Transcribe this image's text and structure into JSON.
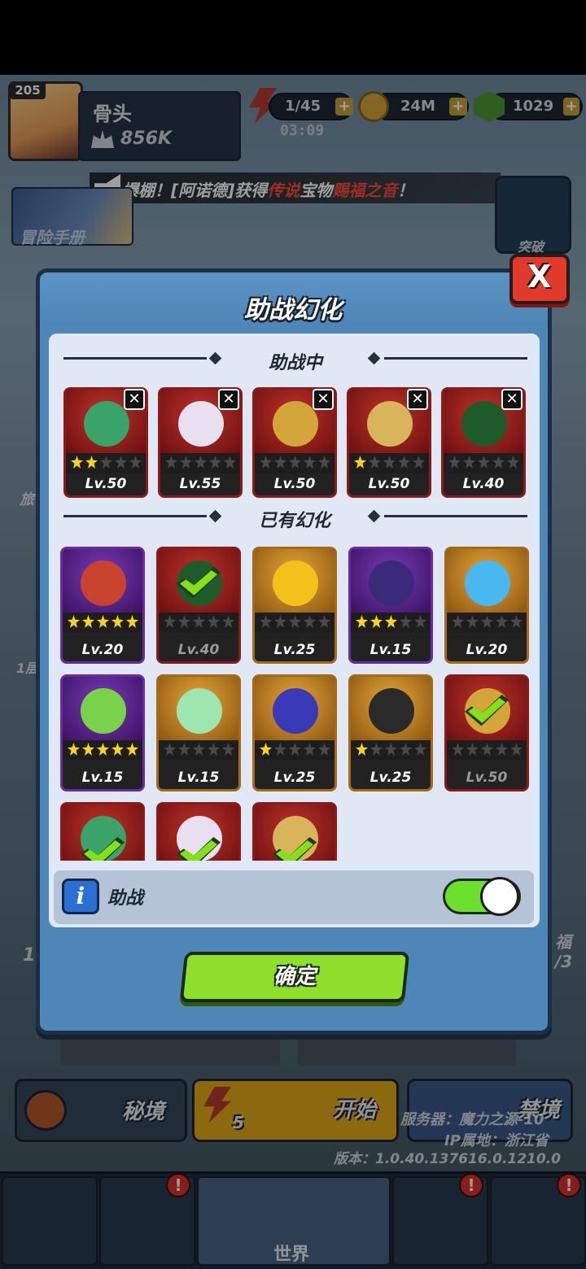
{
  "hud": {
    "player_level": "205",
    "player_name": "骨头",
    "power": "856K",
    "energy": "1/45",
    "energy_timer": "03:09",
    "coins": "24M",
    "gems": "1029",
    "plus_label": "+"
  },
  "ticker": {
    "prefix": "爆棚！[阿诺德]获得",
    "rarity": "传说",
    "middle": "宝物",
    "item": "赐福之音",
    "suffix": "！"
  },
  "side": {
    "handbook_label": "冒险手册"
  },
  "modal": {
    "title": "助战幻化",
    "close_label": "X",
    "active_section_title": "助战中",
    "owned_section_title": "已有幻化",
    "remove_label": "✕",
    "active": [
      {
        "level": "Lv.50",
        "stars": 2,
        "frame": "red",
        "color": "#3aa36a"
      },
      {
        "level": "Lv.55",
        "stars": 0,
        "frame": "red",
        "color": "#e8dff0"
      },
      {
        "level": "Lv.50",
        "stars": 0,
        "frame": "red",
        "color": "#d4a63a"
      },
      {
        "level": "Lv.50",
        "stars": 1,
        "frame": "red",
        "color": "#d8b45a"
      },
      {
        "level": "Lv.40",
        "stars": 0,
        "frame": "red",
        "color": "#1e5a2a"
      }
    ],
    "owned": [
      {
        "level": "Lv.20",
        "stars": 5,
        "frame": "purple",
        "color": "#c8432e",
        "checked": false
      },
      {
        "level": "Lv.40",
        "stars": 0,
        "frame": "red",
        "color": "#1e5a2a",
        "checked": true
      },
      {
        "level": "Lv.25",
        "stars": 0,
        "frame": "gold",
        "color": "#f2c21a",
        "checked": false
      },
      {
        "level": "Lv.15",
        "stars": 3,
        "frame": "purple",
        "color": "#3a2a7a",
        "checked": false
      },
      {
        "level": "Lv.20",
        "stars": 0,
        "frame": "gold",
        "color": "#4ab8f0",
        "checked": false
      },
      {
        "level": "Lv.15",
        "stars": 5,
        "frame": "purple",
        "color": "#7ad24a",
        "checked": false
      },
      {
        "level": "Lv.15",
        "stars": 0,
        "frame": "gold",
        "color": "#9ee6b0",
        "checked": false
      },
      {
        "level": "Lv.25",
        "stars": 1,
        "frame": "gold",
        "color": "#3a3ab8",
        "checked": false
      },
      {
        "level": "Lv.25",
        "stars": 1,
        "frame": "gold",
        "color": "#2a2a2a",
        "checked": false
      },
      {
        "level": "Lv.50",
        "stars": 0,
        "frame": "red",
        "color": "#d4a63a",
        "checked": true
      },
      {
        "level": "",
        "stars": 0,
        "frame": "red",
        "color": "#3aa36a",
        "checked": true
      },
      {
        "level": "",
        "stars": 0,
        "frame": "red",
        "color": "#e8dff0",
        "checked": true
      },
      {
        "level": "",
        "stars": 0,
        "frame": "red",
        "color": "#d8b45a",
        "checked": true
      }
    ],
    "assist_label": "助战",
    "info_label": "i",
    "assist_enabled": true,
    "confirm_label": "确定"
  },
  "bottom": {
    "secret_label": "秘境",
    "start_label": "开始",
    "start_cost": "5",
    "forbidden_label": "禁境",
    "server_line": "服务器：魔力之源-10",
    "ip_line": "IP属地：浙江省",
    "version_line": "版本：1.0.40.137616.0.1210.0",
    "side_left_1": "旅",
    "side_left_2": "1层",
    "side_left_3": "1",
    "side_right_1": "福",
    "side_right_2": "/3",
    "badge_label": "突破",
    "world_label": "世界",
    "alert_label": "!"
  },
  "colors": {
    "modal_bg": "#4e86b8",
    "panel_bg": "#dfe8f4",
    "confirm_green": "#8ee02a",
    "close_red": "#e23a2a",
    "toggle_on": "#6de02c",
    "star_gold": "#ffd31a"
  }
}
